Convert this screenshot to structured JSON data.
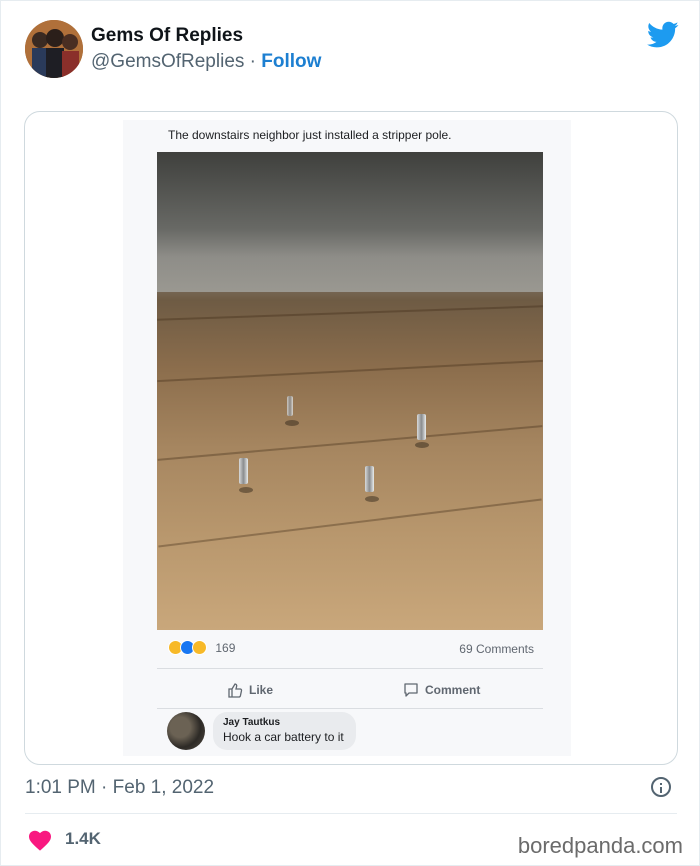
{
  "tweet": {
    "display_name": "Gems Of Replies",
    "handle": "@GemsOfReplies",
    "separator": " · ",
    "follow_label": "Follow",
    "timestamp": "1:01 PM · Feb 1, 2022",
    "like_count": "1.4K"
  },
  "embedded_post": {
    "caption": "The downstairs neighbor just installed a stripper pole.",
    "reaction_count": "169",
    "comments_count": "69 Comments",
    "like_label": "Like",
    "comment_label": "Comment",
    "comment": {
      "author": "Jay Tautkus",
      "text": "Hook a car battery to it"
    }
  },
  "watermark": "boredpanda.com",
  "colors": {
    "accent": "#1d9bf0",
    "follow": "#1d7fd1",
    "heart": "#f91880",
    "secondary_text": "#536471"
  },
  "icons": [
    "twitter-bird-icon",
    "info-icon",
    "heart-icon",
    "thumbs-up-icon",
    "comment-bubble-icon"
  ]
}
